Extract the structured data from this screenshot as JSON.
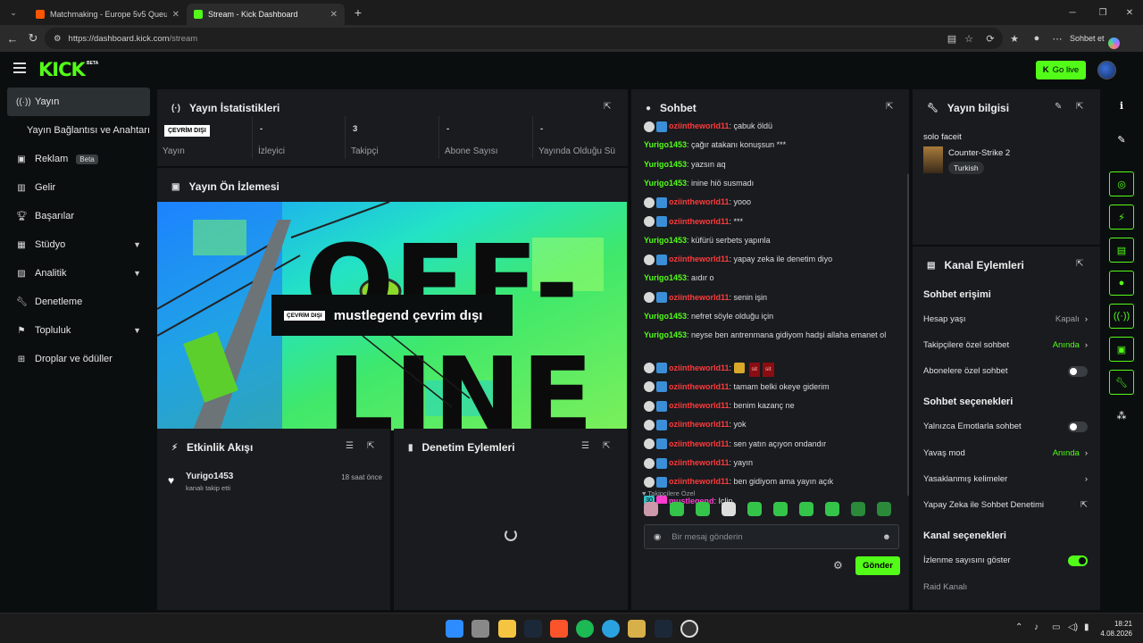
{
  "browser": {
    "tabs": [
      {
        "title": "Matchmaking - Europe 5v5 Queue",
        "active": false
      },
      {
        "title": "Stream - Kick Dashboard",
        "active": true
      }
    ],
    "url_host": "https://dashboard.kick.com",
    "url_path": "/stream",
    "copilot_label": "Sohbet et"
  },
  "kick": {
    "logo": "KICK",
    "logo_sup": "BETA",
    "go_live": "Go live",
    "sidebar": [
      {
        "label": "Yayın",
        "icon": "broadcast-icon",
        "active": true
      },
      {
        "label": "Yayın Bağlantısı ve Anahtarı",
        "icon": "",
        "active": false
      },
      {
        "label": "Reklam",
        "icon": "ad-icon",
        "badge": "Beta"
      },
      {
        "label": "Gelir",
        "icon": "chart-icon"
      },
      {
        "label": "Başarılar",
        "icon": "trophy-icon"
      },
      {
        "label": "Stüdyo",
        "icon": "studio-icon",
        "chevron": true
      },
      {
        "label": "Analitik",
        "icon": "analytics-icon",
        "chevron": true
      },
      {
        "label": "Denetleme",
        "icon": "wrench-icon"
      },
      {
        "label": "Topluluk",
        "icon": "community-icon",
        "chevron": true
      },
      {
        "label": "Droplar ve ödüller",
        "icon": "drops-icon"
      }
    ],
    "stats": {
      "title": "Yayın İstatistikleri",
      "status_tag": "ÇEVRİM DIŞI",
      "cells": [
        {
          "value": "",
          "label": "Yayın"
        },
        {
          "value": "-",
          "label": "İzleyici"
        },
        {
          "value": "3",
          "label": "Takipçi"
        },
        {
          "value": "-",
          "label": "Abone Sayısı"
        },
        {
          "value": "-",
          "label": "Yayında Olduğu Sü"
        }
      ]
    },
    "preview": {
      "title": "Yayın Ön İzlemesi",
      "offline_big_1": "OFF-",
      "offline_big_2": "LINE",
      "tag": "ÇEVRİM DIŞI",
      "text": "mustlegend çevrim dışı"
    },
    "activity": {
      "title": "Etkinlik Akışı",
      "items": [
        {
          "user": "Yurigo1453",
          "text": "kanalı takip etti",
          "time": "18 saat önce"
        }
      ]
    },
    "moderation": {
      "title": "Denetim Eylemleri"
    },
    "chat": {
      "title": "Sohbet",
      "messages": [
        {
          "user": "oziintheworld11",
          "color": "r",
          "badges": true,
          "text": "çabuk öldü"
        },
        {
          "user": "Yurigo1453",
          "color": "g",
          "badges": false,
          "text": "çağır atakanı konuşsun ***"
        },
        {
          "user": "Yurigo1453",
          "color": "g",
          "badges": false,
          "text": "yazsın aq"
        },
        {
          "user": "Yurigo1453",
          "color": "g",
          "badges": false,
          "text": "inine hiö susmadı"
        },
        {
          "user": "oziintheworld11",
          "color": "r",
          "badges": true,
          "text": "yooo"
        },
        {
          "user": "oziintheworld11",
          "color": "r",
          "badges": true,
          "text": "***"
        },
        {
          "user": "Yurigo1453",
          "color": "g",
          "badges": false,
          "text": "küfürü serbets yapınla"
        },
        {
          "user": "oziintheworld11",
          "color": "r",
          "badges": true,
          "text": "yapay zeka ile denetim diyo"
        },
        {
          "user": "Yurigo1453",
          "color": "g",
          "badges": false,
          "text": "aıdır o"
        },
        {
          "user": "oziintheworld11",
          "color": "r",
          "badges": true,
          "text": "senin işin"
        },
        {
          "user": "Yurigo1453",
          "color": "g",
          "badges": false,
          "text": "nefret söyle olduğu için"
        },
        {
          "user": "Yurigo1453",
          "color": "g",
          "badges": false,
          "text": "neyse ben antrenmana gidiyom hadşi allaha emanet ol"
        },
        {
          "user": "oziintheworld11",
          "color": "r",
          "badges": true,
          "text": "",
          "emote_tags": [
            "sit",
            "sit"
          ]
        },
        {
          "user": "oziintheworld11",
          "color": "r",
          "badges": true,
          "text": "tamam belki okeye giderim"
        },
        {
          "user": "oziintheworld11",
          "color": "r",
          "badges": true,
          "text": "benim kazanç ne"
        },
        {
          "user": "oziintheworld11",
          "color": "r",
          "badges": true,
          "text": "yok"
        },
        {
          "user": "oziintheworld11",
          "color": "r",
          "badges": true,
          "text": "sen yatın açıyon ondandır"
        },
        {
          "user": "oziintheworld11",
          "color": "r",
          "badges": true,
          "text": "yayın"
        },
        {
          "user": "oziintheworld11",
          "color": "r",
          "badges": true,
          "text": "ben gidiyom ama yayın açık"
        },
        {
          "user": "mustlegend",
          "color": "p",
          "badges": true,
          "badge_num": "30",
          "text": "Iclip"
        }
      ],
      "followers_only": "Takipçilere Özel",
      "placeholder": "Bir mesaj gönderin",
      "send": "Gönder"
    },
    "stream_info": {
      "title": "Yayın bilgisi",
      "stream_title": "solo faceit",
      "game": "Counter-Strike 2",
      "tag": "Turkish"
    },
    "channel_actions": {
      "title": "Kanal Eylemleri",
      "chat_access": "Sohbet erişimi",
      "account_age": "Hesap yaşı",
      "account_age_val": "Kapalı",
      "followers_chat": "Takipçilere özel sohbet",
      "followers_chat_val": "Anında",
      "subs_chat": "Abonelere özel sohbet",
      "chat_options": "Sohbet seçenekleri",
      "emote_only": "Yalnızca Emotlarla sohbet",
      "slow_mode": "Yavaş mod",
      "slow_mode_val": "Anında",
      "banned_words": "Yasaklanmış kelimeler",
      "ai_moderation": "Yapay Zeka ile Sohbet Denetimi",
      "channel_options": "Kanal seçenekleri",
      "show_viewers": "İzlenme sayısını göster",
      "raid": "Raid Kanalı"
    }
  },
  "taskbar": {
    "time": "18:21",
    "date": "4.08.2026"
  }
}
